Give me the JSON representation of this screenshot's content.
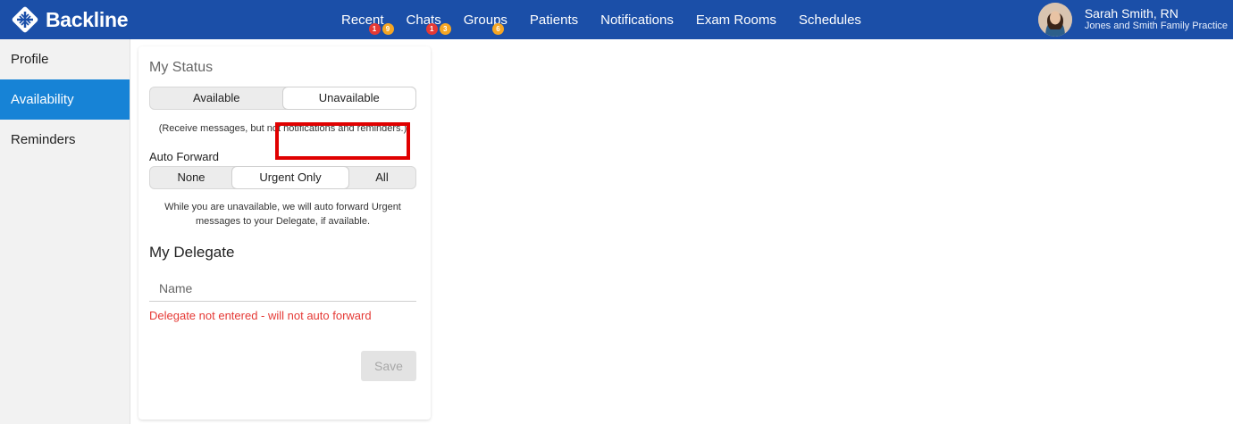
{
  "brand": {
    "name": "Backline"
  },
  "nav": {
    "items": [
      {
        "label": "Recent",
        "badges": [
          "1",
          "9"
        ]
      },
      {
        "label": "Chats",
        "badges": [
          "1",
          "3"
        ]
      },
      {
        "label": "Groups",
        "badges": [
          "6"
        ]
      },
      {
        "label": "Patients"
      },
      {
        "label": "Notifications"
      },
      {
        "label": "Exam Rooms"
      },
      {
        "label": "Schedules"
      }
    ]
  },
  "user": {
    "name": "Sarah Smith, RN",
    "org": "Jones and Smith Family Practice"
  },
  "sidebar": {
    "items": [
      {
        "label": "Profile"
      },
      {
        "label": "Availability",
        "active": true
      },
      {
        "label": "Reminders"
      }
    ]
  },
  "status": {
    "title": "My Status",
    "options": [
      "Available",
      "Unavailable"
    ],
    "selected": "Unavailable",
    "note": "(Receive messages, but not notifications and reminders.)"
  },
  "auto_forward": {
    "label": "Auto Forward",
    "options": [
      "None",
      "Urgent Only",
      "All"
    ],
    "selected": "Urgent Only",
    "note_line1": "While you are unavailable, we will auto forward Urgent",
    "note_line2": "messages to your Delegate, if available."
  },
  "delegate": {
    "title": "My Delegate",
    "placeholder": "Name",
    "error": "Delegate not entered - will not auto forward"
  },
  "actions": {
    "save_label": "Save"
  },
  "colors": {
    "topbar": "#1b4fa8",
    "sidebar_active": "#1783d6",
    "error": "#e53935",
    "highlight": "#e00000"
  }
}
